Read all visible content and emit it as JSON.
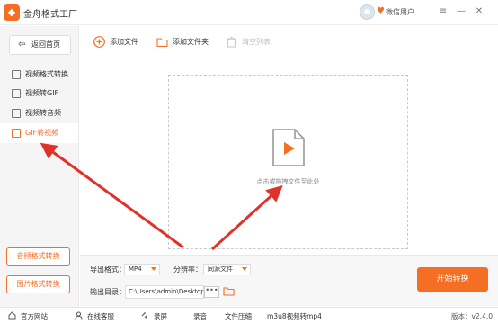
{
  "app": {
    "title": "金舟格式工厂",
    "user_label": "微信用户"
  },
  "window_controls": {
    "menu": "≡",
    "minimize": "—",
    "close": "✕"
  },
  "sidebar": {
    "back_label": "返回首页",
    "items": [
      {
        "label": "视频格式转换",
        "active": false
      },
      {
        "label": "视频转GIF",
        "active": false
      },
      {
        "label": "视频转音频",
        "active": false
      },
      {
        "label": "GIF转视频",
        "active": true
      }
    ],
    "audio_convert_label": "音频格式转换",
    "image_convert_label": "图片格式转换"
  },
  "toolbar": {
    "add_file_label": "添加文件",
    "add_folder_label": "添加文件夹",
    "clear_list_label": "清空列表"
  },
  "dropzone": {
    "text": "点击或拖拽文件至此处"
  },
  "settings": {
    "export_format_label": "导出格式：",
    "export_format_value": "MP4",
    "resolution_label": "分辨率：",
    "resolution_value": "同源文件",
    "output_dir_label": "输出目录：",
    "output_dir_value": "C:\\Users\\admin\\Desktop\\",
    "more_label": "•••"
  },
  "start_button_label": "开始转换",
  "statusbar": {
    "website": "官方网站",
    "support": "在线客服",
    "record": "录屏",
    "audio": "录音",
    "compress": "文件压缩",
    "m3u8": "m3u8视频转mp4",
    "version": "版本：v2.4.0"
  },
  "colors": {
    "accent": "#f46f24",
    "arrow": "#e0322a"
  }
}
